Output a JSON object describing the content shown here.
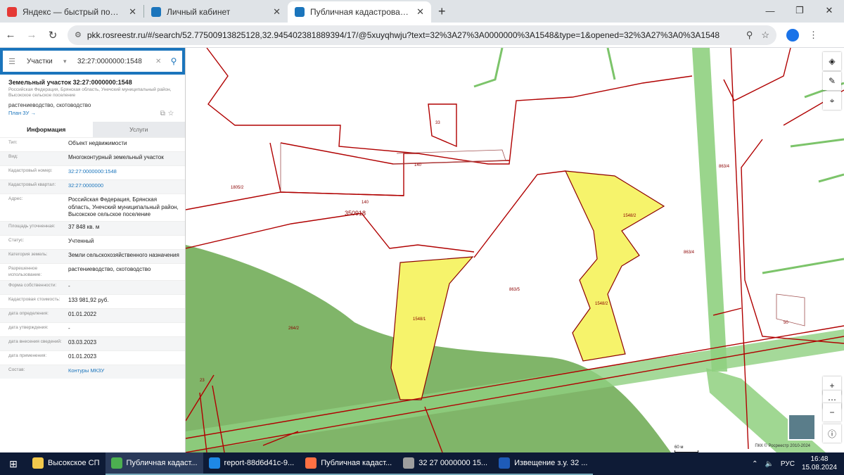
{
  "browser": {
    "tabs": [
      {
        "title": "Яндекс — быстрый поиск в ин",
        "color": "#e53935",
        "active": false
      },
      {
        "title": "Личный кабинет",
        "color": "#1b75bc",
        "active": false
      },
      {
        "title": "Публичная кадастровая карта",
        "color": "#1b75bc",
        "active": true
      }
    ],
    "new_tab": "+",
    "url": "pkk.rosreestr.ru/#/search/52.77500913825128,32.945402381889394/17/@5xuyqhwju?text=32%3A27%3A0000000%3A1548&type=1&opened=32%3A27%3A0%3A1548"
  },
  "search": {
    "type_label": "Участки",
    "query": "32:27:0000000:1548"
  },
  "object": {
    "title": "Земельный участок 32:27:0000000:1548",
    "address_short": "Российская Федерация, Брянская область, Унечский муниципальный район, Высокское сельское поселение",
    "use": "растениеводство, скотоводство",
    "plan_link": "План ЗУ →"
  },
  "tabs": {
    "info": "Информация",
    "services": "Услуги"
  },
  "props": [
    {
      "label": "Тип:",
      "value": "Объект недвижимости",
      "link": false
    },
    {
      "label": "Вид:",
      "value": "Многоконтурный земельный участок",
      "link": false
    },
    {
      "label": "Кадастровый номер:",
      "value": "32:27:0000000:1548",
      "link": true
    },
    {
      "label": "Кадастровый квартал:",
      "value": "32:27:0000000",
      "link": true
    },
    {
      "label": "Адрес:",
      "value": "Российская Федерация, Брянская область, Унечский муниципальный район, Высокское сельское поселение",
      "link": false
    },
    {
      "label": "Площадь уточненная:",
      "value": "37 848 кв. м",
      "link": false
    },
    {
      "label": "Статус:",
      "value": "Учтенный",
      "link": false
    },
    {
      "label": "Категория земель:",
      "value": "Земли сельскохозяйственного назначения",
      "link": false
    },
    {
      "label": "Разрешенное использование:",
      "value": "растениеводство, скотоводство",
      "link": false
    },
    {
      "label": "Форма собственности:",
      "value": "-",
      "link": false
    },
    {
      "label": "Кадастровая стоимость:",
      "value": "133 981,92 руб.",
      "link": false
    },
    {
      "label": "дата определения:",
      "value": "01.01.2022",
      "link": false
    },
    {
      "label": "дата утверждения:",
      "value": "-",
      "link": false
    },
    {
      "label": "дата внесения сведений:",
      "value": "03.03.2023",
      "link": false
    },
    {
      "label": "дата применения:",
      "value": "01.01.2023",
      "link": false
    },
    {
      "label": "Состав:",
      "value": "Контуры МКЗУ",
      "link": true
    }
  ],
  "map": {
    "labels": [
      "1805/2",
      "140",
      "140",
      "350918",
      "33",
      "1548/2",
      "1548/2",
      "1548/1",
      "863/5",
      "863/4",
      "863/4",
      "264/2",
      "50",
      "23"
    ],
    "scale": "60 м",
    "copyright": "ПКК © Росреестр 2010-2024"
  },
  "taskbar": {
    "items": [
      {
        "title": "Высокское СП",
        "color": "#f2c94c",
        "state": ""
      },
      {
        "title": "Публичная кадаст...",
        "color": "#4caf50",
        "state": "active"
      },
      {
        "title": "report-88d6d41c-9...",
        "color": "#1e88e5",
        "state": "open"
      },
      {
        "title": "Публичная кадаст...",
        "color": "#ff7043",
        "state": "open"
      },
      {
        "title": "32 27 0000000 15...",
        "color": "#9e9e9e",
        "state": "open"
      },
      {
        "title": "Извещение з.у. 32 ...",
        "color": "#1e5bb8",
        "state": "open"
      }
    ],
    "lang": "РУС",
    "time": "16:48",
    "date": "15.08.2024"
  }
}
